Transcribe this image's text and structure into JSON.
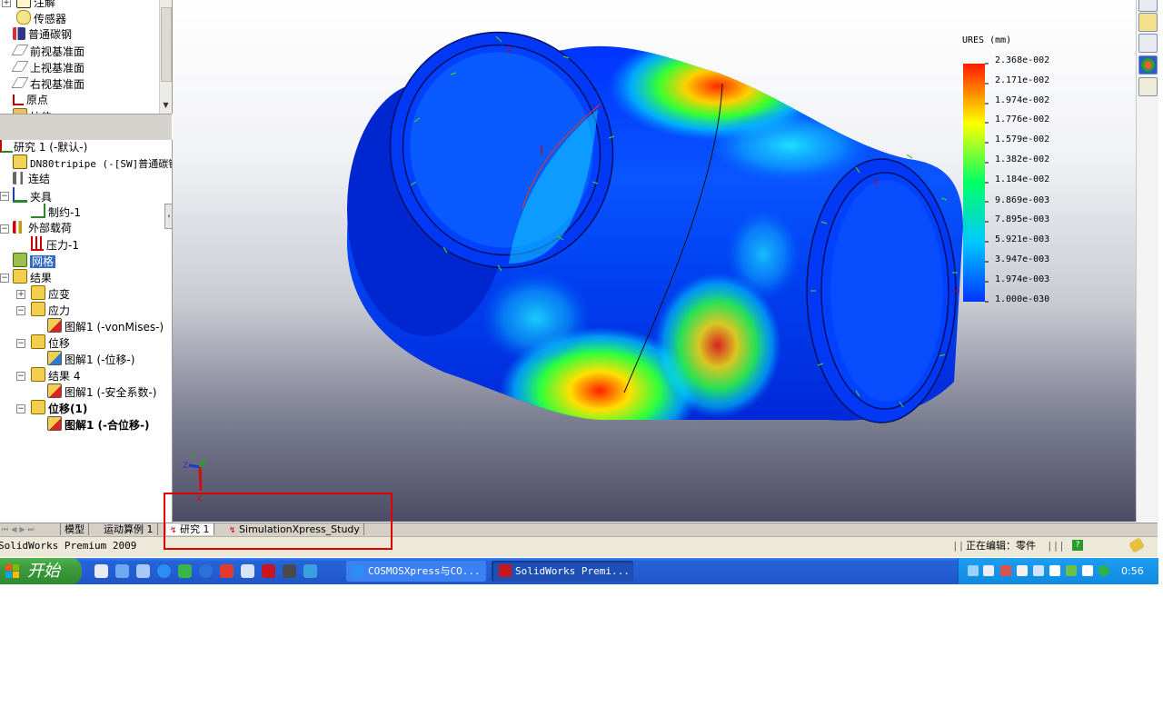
{
  "feature_tree_top": [
    {
      "label": "注解",
      "icon": "annotation-icon"
    },
    {
      "label": "传感器",
      "icon": "sensor-icon"
    },
    {
      "label": "普通碳钢",
      "icon": "material-icon"
    },
    {
      "label": "前视基准面",
      "icon": "plane-icon"
    },
    {
      "label": "上视基准面",
      "icon": "plane-icon"
    },
    {
      "label": "右视基准面",
      "icon": "plane-icon"
    },
    {
      "label": "原点",
      "icon": "origin-icon"
    },
    {
      "label": "拉伸",
      "icon": "extrude-icon"
    }
  ],
  "simulation_tree": {
    "study": "研究 1 (-默认-)",
    "part": "DN80tripipe (-[SW]普通碳钢",
    "connections": "连结",
    "fixtures": "夹具",
    "fixture_1": "制约-1",
    "external_loads": "外部载荷",
    "pressure_1": "压力-1",
    "mesh": "网格",
    "results": "结果",
    "strain": "应变",
    "stress": "应力",
    "stress_plot": "图解1 (-vonMises-)",
    "displacement": "位移",
    "displacement_plot": "图解1 (-位移-)",
    "results4": "结果 4",
    "results4_plot": "图解1 (-安全系数-)",
    "displacement1": "位移(1)",
    "displacement1_plot": "图解1 (-合位移-)"
  },
  "legend": {
    "title": "URES (mm)",
    "values": [
      "2.368e-002",
      "2.171e-002",
      "1.974e-002",
      "1.776e-002",
      "1.579e-002",
      "1.382e-002",
      "1.184e-002",
      "9.869e-003",
      "7.895e-003",
      "5.921e-003",
      "3.947e-003",
      "1.974e-003",
      "1.000e-030"
    ],
    "colors": [
      "#ff1a00",
      "#ffff00",
      "#00ff66",
      "#00c8ff",
      "#0033ff"
    ]
  },
  "triad": {
    "z": "Z",
    "y": "Y",
    "x": "X"
  },
  "tabs": {
    "model": "模型",
    "motion": "运动算例 1",
    "study": "研究 1",
    "xpress": "SimulationXpress_Study"
  },
  "status": {
    "left": "SolidWorks Premium 2009",
    "editing": "正在编辑：零件"
  },
  "taskbar": {
    "start": "开始",
    "task1": "COSMOSXpress与CO...",
    "task2": "SolidWorks Premi...",
    "clock": "0:56"
  },
  "colors": {
    "highlight": "#e00000",
    "selection": "#316ac5",
    "taskbar": "#235fd6",
    "start": "#3c9a3c"
  }
}
